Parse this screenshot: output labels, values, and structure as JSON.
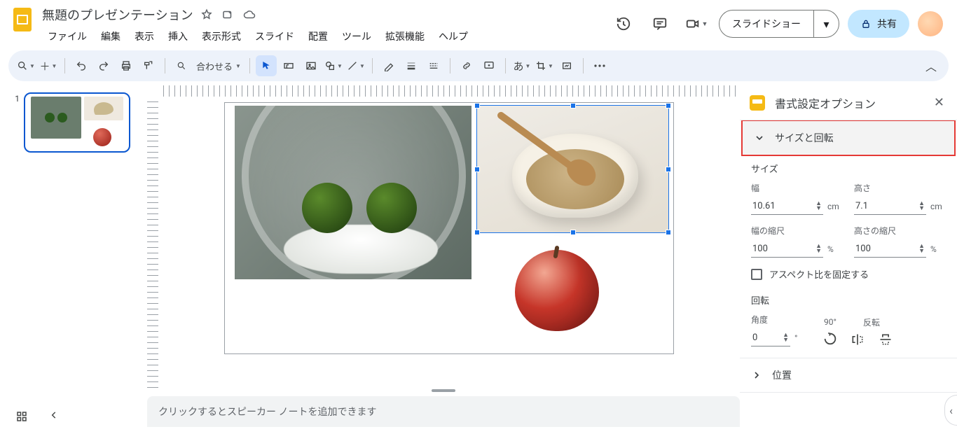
{
  "header": {
    "title": "無題のプレゼンテーション",
    "slideshow_label": "スライドショー",
    "share_label": "共有"
  },
  "menus": [
    "ファイル",
    "編集",
    "表示",
    "挿入",
    "表示形式",
    "スライド",
    "配置",
    "ツール",
    "拡張機能",
    "ヘルプ"
  ],
  "toolbar": {
    "zoom_label": "合わせる"
  },
  "thumbnails": {
    "slide1_num": "1"
  },
  "notes": {
    "placeholder": "クリックするとスピーカー ノートを追加できます"
  },
  "format_panel": {
    "title": "書式設定オプション",
    "sections": {
      "size_rotate": {
        "heading": "サイズと回転",
        "size_label": "サイズ",
        "width_label": "幅",
        "height_label": "高さ",
        "width_value": "10.61",
        "height_value": "7.1",
        "cm_unit": "cm",
        "width_scale_label": "幅の縮尺",
        "height_scale_label": "高さの縮尺",
        "width_scale_value": "100",
        "height_scale_value": "100",
        "percent_unit": "%",
        "lock_aspect_label": "アスペクト比を固定する",
        "rotation_label": "回転",
        "angle_label": "角度",
        "angle_value": "0",
        "deg_unit": "°",
        "quick90_label": "90°",
        "flip_label": "反転"
      },
      "position": {
        "heading": "位置"
      }
    }
  }
}
